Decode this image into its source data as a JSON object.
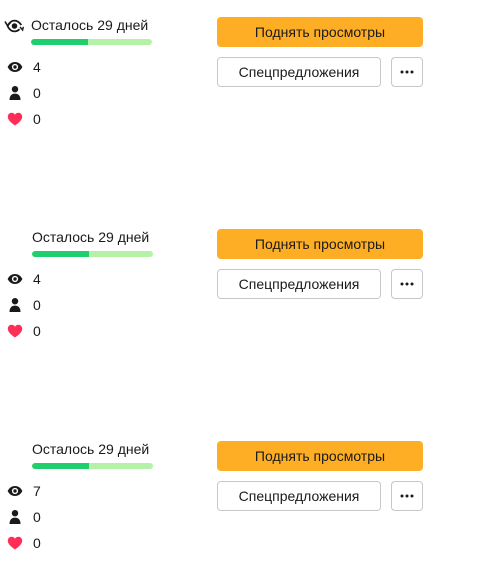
{
  "colors": {
    "promote_button": "#fdae24",
    "progress_done": "#1fcf6d",
    "progress_remaining": "#b4f2a7",
    "favorite_icon": "#ff2e58",
    "text": "#1a1a1a",
    "outline_border": "#c8c8c8"
  },
  "listings": [
    {
      "status_icon": "eye-with-refresh-icon",
      "days_left_label": "Осталось 29 дней",
      "progress_fraction": 0.47,
      "views": "4",
      "contacts": "0",
      "favorites": "0",
      "promote_label": "Поднять просмотры",
      "special_offers_label": "Спецпредложения",
      "more_icon": "ellipsis-icon"
    },
    {
      "status_icon": null,
      "days_left_label": "Осталось 29 дней",
      "progress_fraction": 0.47,
      "views": "4",
      "contacts": "0",
      "favorites": "0",
      "promote_label": "Поднять просмотры",
      "special_offers_label": "Спецпредложения",
      "more_icon": "ellipsis-icon"
    },
    {
      "status_icon": null,
      "days_left_label": "Осталось 29 дней",
      "progress_fraction": 0.47,
      "views": "7",
      "contacts": "0",
      "favorites": "0",
      "promote_label": "Поднять просмотры",
      "special_offers_label": "Спецпредложения",
      "more_icon": "ellipsis-icon"
    }
  ]
}
